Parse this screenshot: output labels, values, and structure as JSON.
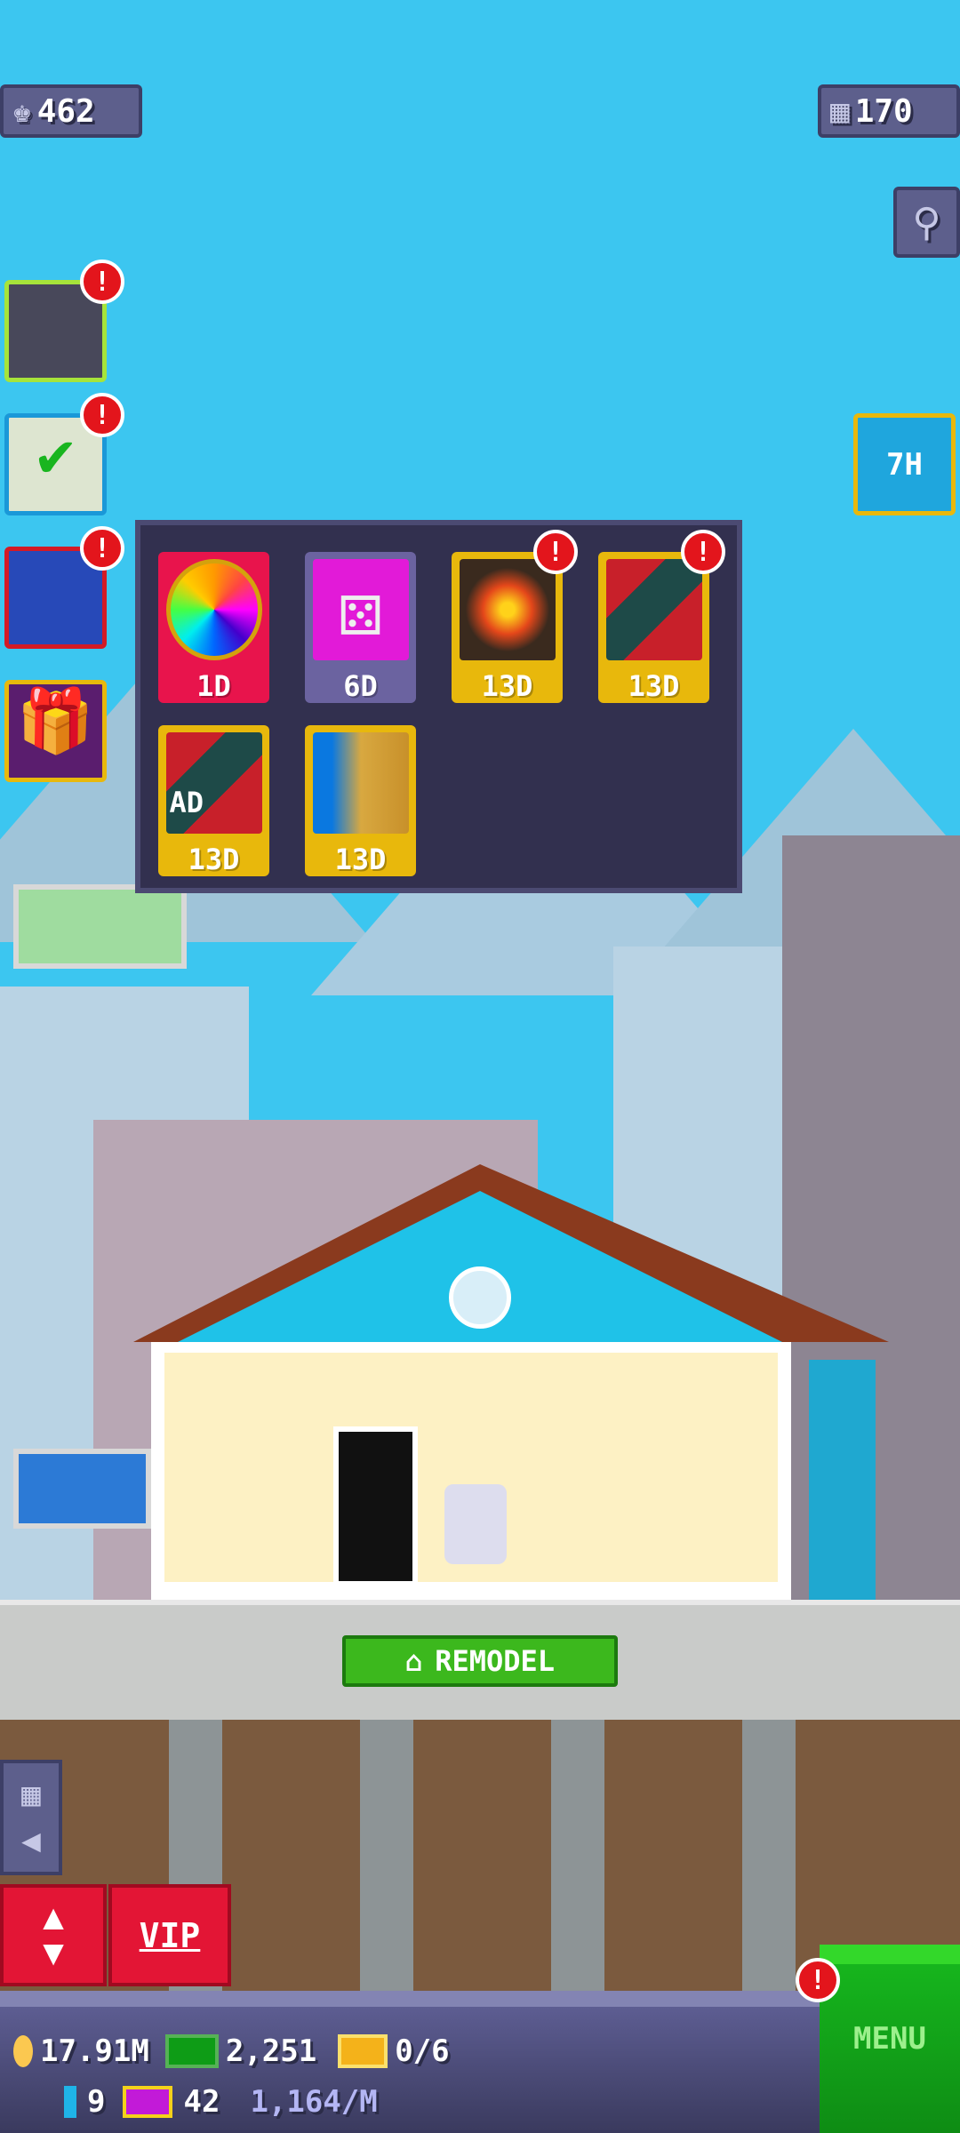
{
  "top": {
    "population": "462",
    "floors": "170"
  },
  "timer_badge": "7H",
  "side_buttons": [
    {
      "name": "building",
      "alert": "!"
    },
    {
      "name": "missions",
      "alert": "!"
    },
    {
      "name": "calendar",
      "alert": "!"
    },
    {
      "name": "gift"
    }
  ],
  "events": [
    {
      "name": "wheel",
      "label": "1D"
    },
    {
      "name": "dice",
      "label": "6D"
    },
    {
      "name": "lantern",
      "label": "13D",
      "alert": "!"
    },
    {
      "name": "red-envelopes",
      "label": "13D",
      "alert": "!"
    },
    {
      "name": "red-envelopes-ad",
      "label": "13D",
      "overlay": "AD"
    },
    {
      "name": "dragon",
      "label": "13D"
    }
  ],
  "remodel_label": "REMODEL",
  "vip_label": "VIP",
  "menu_label": "MENU",
  "menu_alert": "!",
  "stats": {
    "coins": "17.91M",
    "bux": "2,251",
    "golden_tickets": "0/6",
    "batteries": "9",
    "vip_tickets": "42",
    "rate": "1,164/M"
  },
  "colors": {
    "sky": "#3cc6f0",
    "menu": "#16b51d",
    "alert": "#e3151c",
    "vip": "#e31535"
  }
}
